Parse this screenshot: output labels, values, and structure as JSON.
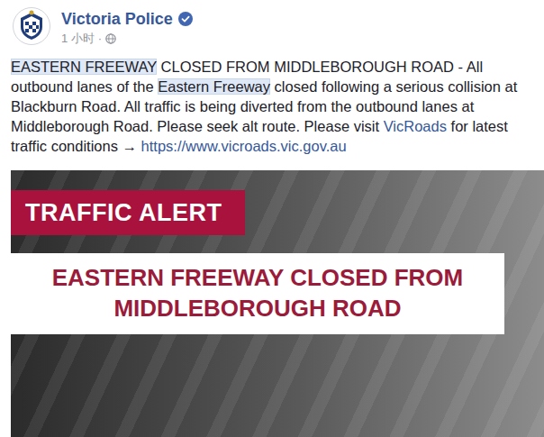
{
  "page": {
    "name": "Victoria Police",
    "verified": true,
    "time": "1 小时",
    "separator": "·"
  },
  "post": {
    "segments": [
      {
        "text": "EASTERN FREEWAY",
        "kind": "highlight"
      },
      {
        "text": " CLOSED FROM MIDDLEBOROUGH ROAD - All outbound lanes of the ",
        "kind": "plain"
      },
      {
        "text": "Eastern Freeway",
        "kind": "highlight"
      },
      {
        "text": " closed following a serious collision at Blackburn Road. All traffic is being diverted from the outbound lanes at Middleborough Road. Please seek alt route. Please visit ",
        "kind": "plain"
      },
      {
        "text": "VicRoads",
        "kind": "link"
      },
      {
        "text": " for latest traffic conditions → ",
        "kind": "plain"
      },
      {
        "text": "https://www.vicroads.vic.gov.au",
        "kind": "link"
      }
    ]
  },
  "image": {
    "banner": "TRAFFIC ALERT",
    "headline": [
      "EASTERN FREEWAY CLOSED FROM",
      "MIDDLEBOROUGH ROAD"
    ]
  }
}
